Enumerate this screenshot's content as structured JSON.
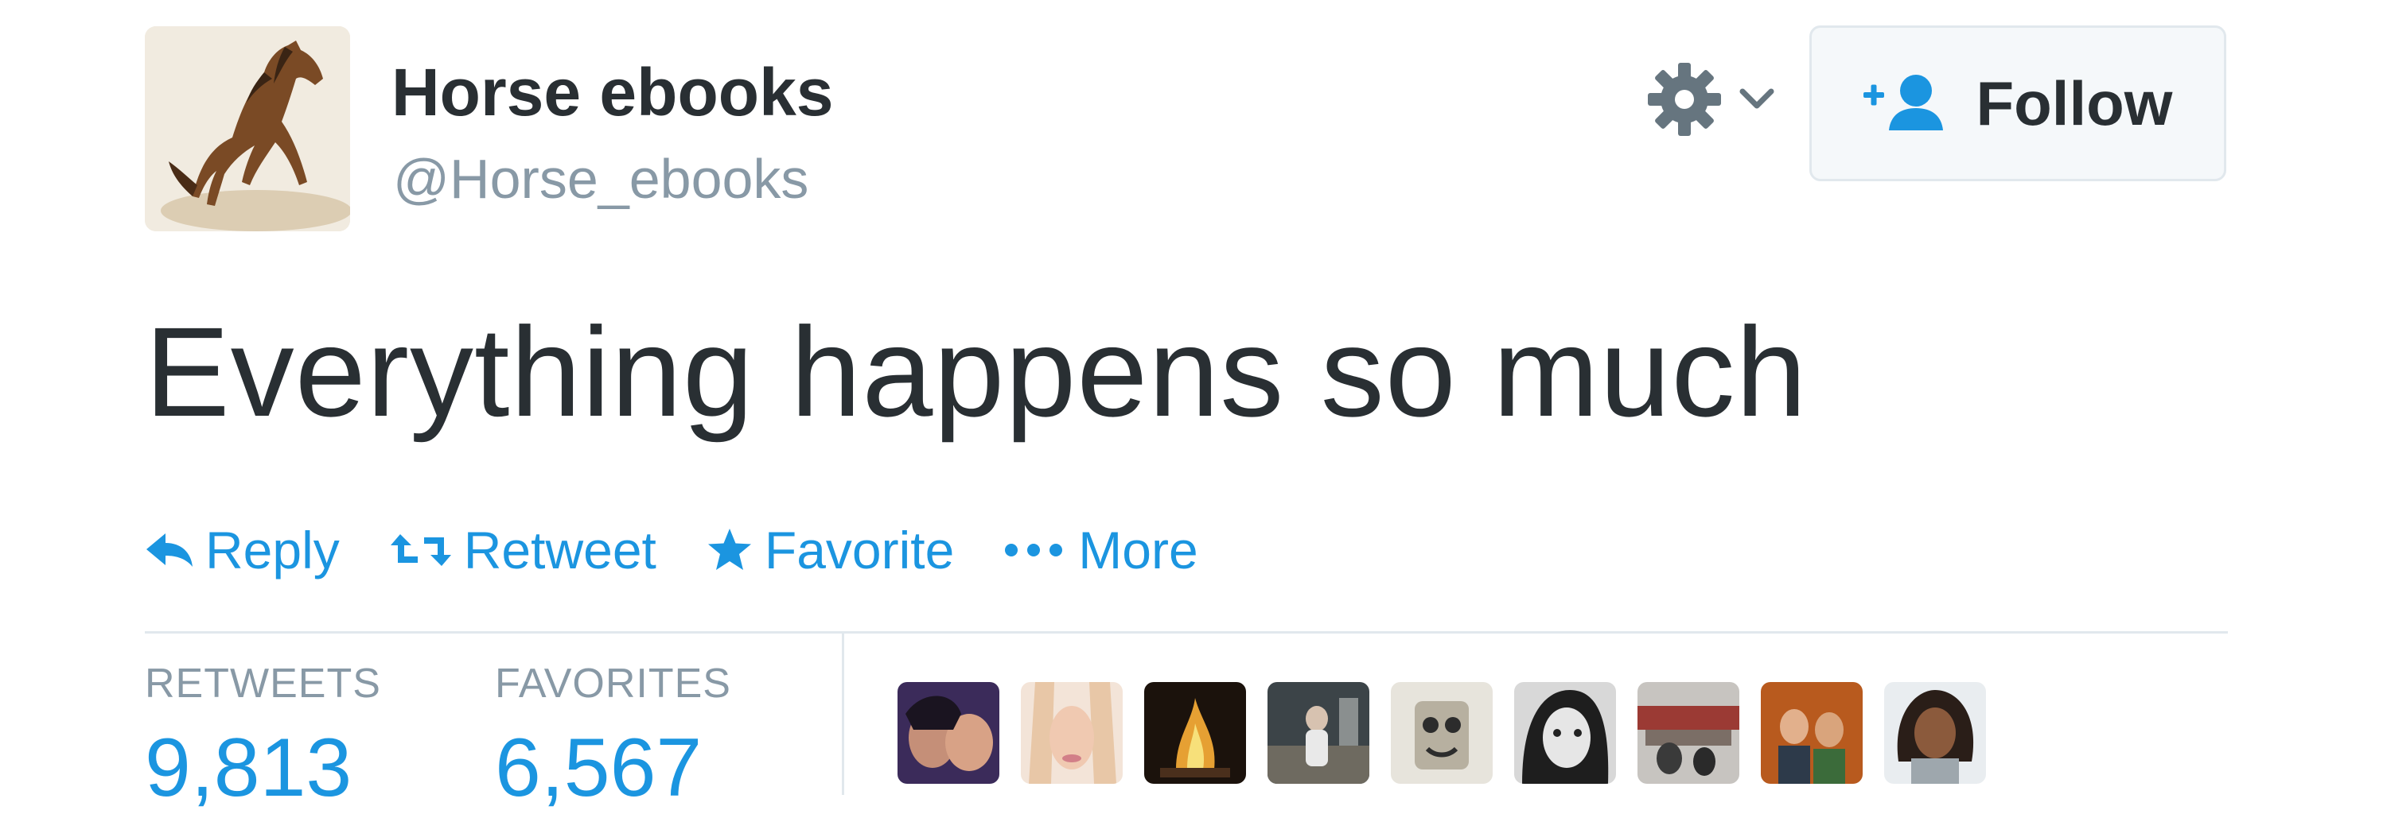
{
  "user": {
    "name": "Horse ebooks",
    "handle": "@Horse_ebooks"
  },
  "header": {
    "gear_icon": "gear-icon",
    "caret_icon": "chevron-down-icon",
    "follow_icon": "add-user-icon",
    "follow_label": "Follow"
  },
  "tweet": {
    "text": "Everything happens so much"
  },
  "actions": [
    {
      "icon": "reply-icon",
      "label": "Reply"
    },
    {
      "icon": "retweet-icon",
      "label": "Retweet"
    },
    {
      "icon": "star-icon",
      "label": "Favorite"
    },
    {
      "icon": "more-dots-icon",
      "label": "More"
    }
  ],
  "stats": {
    "retweets_label": "RETWEETS",
    "retweets_value": "9,813",
    "favorites_label": "FAVORITES",
    "favorites_value": "6,567"
  },
  "colors": {
    "accent": "#1b95e0",
    "text": "#292f33",
    "muted": "#8899a6",
    "border": "#e1e8ed"
  },
  "favoriter_avatar_count": 9
}
